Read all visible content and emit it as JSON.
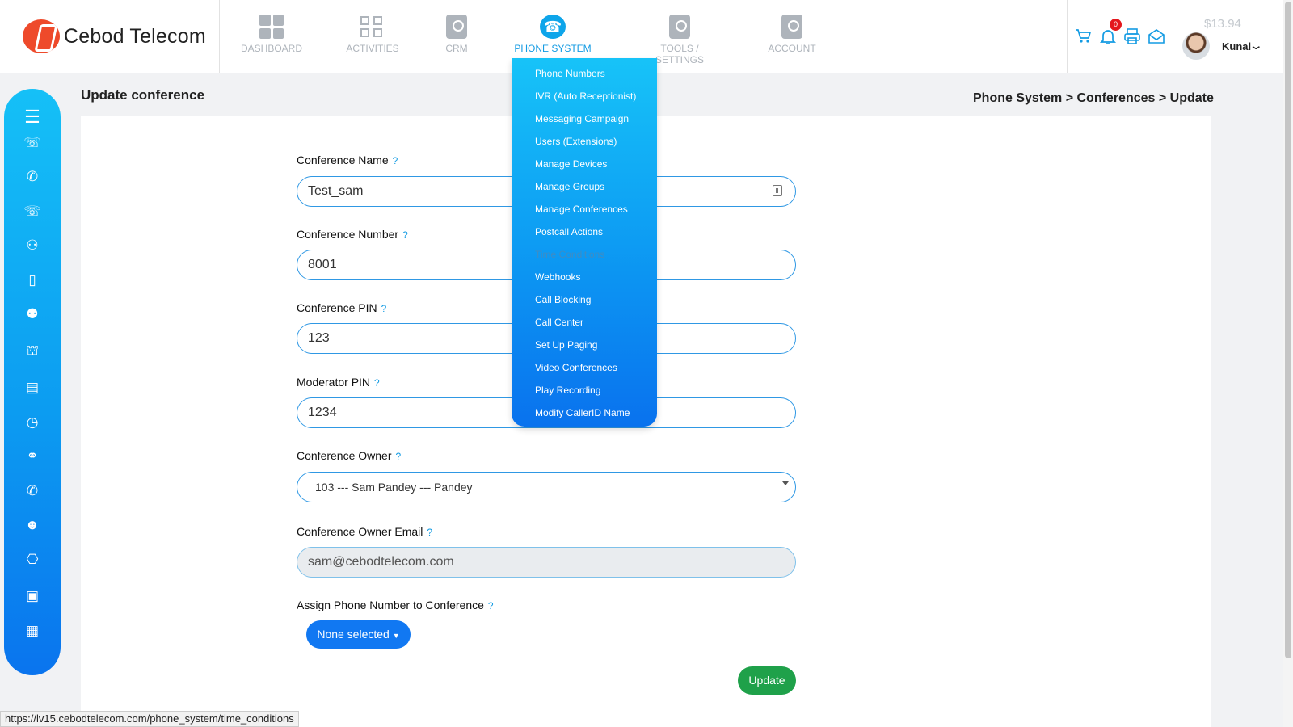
{
  "header": {
    "brand": "Cebod Telecom",
    "nav": [
      {
        "label": "DASHBOARD",
        "icon": "dashboard-icon"
      },
      {
        "label": "ACTIVITIES",
        "icon": "activities-icon"
      },
      {
        "label": "CRM",
        "icon": "crm-icon"
      },
      {
        "label": "PHONE SYSTEM",
        "icon": "phone-system-icon",
        "active": true
      },
      {
        "label": "TOOLS / SETTINGS",
        "icon": "tools-icon"
      },
      {
        "label": "ACCOUNT",
        "icon": "account-icon"
      }
    ],
    "notification_count": "0",
    "balance": "$13.94",
    "username": "Kunal",
    "accent_color": "#139be3"
  },
  "dropdown": {
    "items": [
      "Phone Numbers",
      "IVR (Auto Receptionist)",
      "Messaging Campaign",
      "Users (Extensions)",
      "Manage Devices",
      "Manage Groups",
      "Manage Conferences",
      "Postcall Actions",
      "Time Conditions",
      "Webhooks",
      "Call Blocking",
      "Call Center",
      "Set Up Paging",
      "Video Conferences",
      "Play Recording",
      "Modify CallerID Name"
    ],
    "hovered_item": "Time Conditions"
  },
  "page": {
    "title": "Update conference",
    "breadcrumb": "Phone System > Conferences > Update"
  },
  "form": {
    "help": "?",
    "conference_name": {
      "label": "Conference Name",
      "value": "Test_sam"
    },
    "conference_number": {
      "label": "Conference Number",
      "value": "8001"
    },
    "conference_pin": {
      "label": "Conference PIN",
      "value": "123"
    },
    "moderator_pin": {
      "label": "Moderator PIN",
      "value": "1234"
    },
    "conference_owner": {
      "label": "Conference Owner",
      "value": "103 --- Sam Pandey --- Pandey"
    },
    "owner_email": {
      "label": "Conference Owner Email",
      "value": "sam@cebodtelecom.com"
    },
    "assign_number": {
      "label": "Assign Phone Number to Conference",
      "button": "None selected"
    },
    "update_button": "Update"
  },
  "sidebar": {
    "icons": [
      "menu-icon",
      "ivr-icon",
      "phone-icon",
      "ivr-keypad-icon",
      "users-icon",
      "devices-icon",
      "groups-icon",
      "conference-icon",
      "postcall-icon",
      "time-icon",
      "webhook-icon",
      "call-blocking-icon",
      "call-center-icon",
      "paging-icon",
      "video-icon",
      "caller-id-icon"
    ]
  },
  "status_bar": {
    "url": "https://lv15.cebodtelecom.com/phone_system/time_conditions"
  }
}
